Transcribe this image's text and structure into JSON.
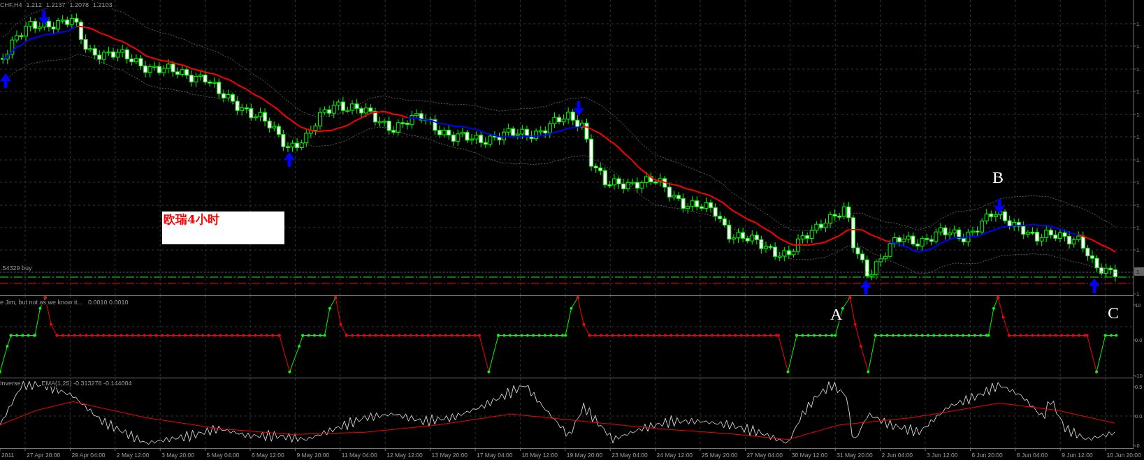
{
  "main_chart": {
    "symbol": "CHF,H4",
    "quotes": [
      "1.212",
      "1.2137",
      "1.2078",
      "1.2103"
    ],
    "order_label": ".54329 buy",
    "note": "欧瑞4小时",
    "price_axis": [
      "1.",
      "1.",
      "1.",
      "1.",
      "1.",
      "1.",
      "1.",
      "1.",
      "1.",
      "1.",
      "1.",
      "1."
    ],
    "current_price_tag": "1."
  },
  "annotations": [
    {
      "label": "A"
    },
    {
      "label": "B"
    },
    {
      "label": "C"
    }
  ],
  "indicators": [
    {
      "title": "e Jim, but not as we know it...",
      "values": "0.0010 0.0010",
      "axis": [
        "10",
        "0.0",
        "-10"
      ]
    },
    {
      "title": "Inverse",
      "values": "EMA(1,25) -0.313278 -0.144004",
      "axis": [
        "0.5",
        "0.0",
        "-0."
      ]
    }
  ],
  "time_axis": [
    "2011",
    "27 Apr 20:00",
    "29 Apr 04:00",
    "2 May 12:00",
    "3 May 20:00",
    "5 May 04:00",
    "6 May 12:00",
    "9 May 20:00",
    "11 May 04:00",
    "12 May 12:00",
    "13 May 20:00",
    "17 May 04:00",
    "18 May 12:00",
    "19 May 20:00",
    "23 May 04:00",
    "24 May 12:00",
    "25 May 20:00",
    "27 May 04:00",
    "30 May 12:00",
    "31 May 20:00",
    "2 Jun 04:00",
    "3 Jun 12:00",
    "6 Jun 20:00",
    "8 Jun 04:00",
    "9 Jun 12:00",
    "10 Jun 20:00"
  ]
}
